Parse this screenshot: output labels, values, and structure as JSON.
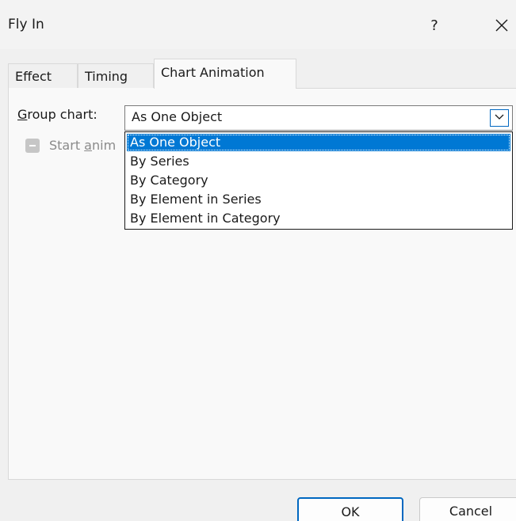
{
  "window": {
    "title": "Fly In",
    "help_label": "?",
    "close_icon": "close-icon"
  },
  "tabs": [
    {
      "label": "Effect",
      "active": false
    },
    {
      "label": "Timing",
      "active": false
    },
    {
      "label": "Chart Animation",
      "active": true
    }
  ],
  "group_chart": {
    "label_mnemonic": "G",
    "label_rest": "roup chart:",
    "value": "As One Object",
    "options": [
      "As One Object",
      "By Series",
      "By Category",
      "By Element in Series",
      "By Element in Category"
    ],
    "selected_index": 0
  },
  "start_animation": {
    "label_start": "Start ",
    "label_mnemonic": "a",
    "label_rest": "nim",
    "disabled": true,
    "state": "indeterminate"
  },
  "footer": {
    "ok_label": "OK",
    "cancel_label": "Cancel"
  },
  "colors": {
    "accent": "#0078d4",
    "border_focus": "#0067c0"
  }
}
